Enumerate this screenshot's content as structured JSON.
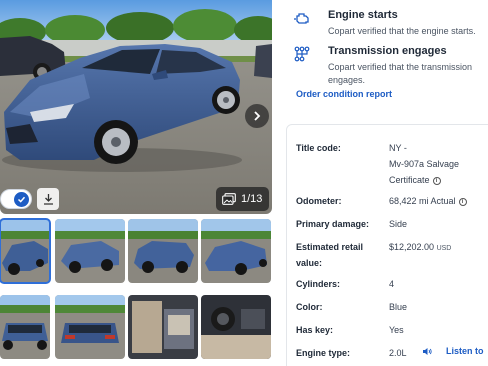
{
  "gallery": {
    "photo_counter": "1/13",
    "next_icon": "chevron-right-icon",
    "download_icon": "download-icon",
    "toggle_icon": "checkmark-icon",
    "gallery_icon": "images-icon"
  },
  "verifications": [
    {
      "icon": "engine-icon",
      "title": "Engine starts",
      "description": "Copart verified that the engine starts."
    },
    {
      "icon": "transmission-icon",
      "title": "Transmission engages",
      "description": "Copart verified that the transmission engages."
    }
  ],
  "order_condition_report": "Order condition report",
  "details": {
    "title_code": {
      "label": "Title code:",
      "value": "NY -\nMv-907a Salvage Certificate"
    },
    "odometer": {
      "label": "Odometer:",
      "value": "68,422 mi Actual"
    },
    "primary_damage": {
      "label": "Primary damage:",
      "value": "Side"
    },
    "estimated_retail_value": {
      "label": "Estimated retail value:",
      "value": "$12,202.00",
      "currency": "USD"
    },
    "cylinders": {
      "label": "Cylinders:",
      "value": "4"
    },
    "color": {
      "label": "Color:",
      "value": "Blue"
    },
    "has_key": {
      "label": "Has key:",
      "value": "Yes"
    },
    "engine_type": {
      "label": "Engine type:",
      "value": "2.0L"
    }
  },
  "listen": {
    "label": "Listen to",
    "icon": "speaker-icon"
  },
  "colors": {
    "accent": "#1d5cc4",
    "car_blue": "#3f5f96"
  }
}
